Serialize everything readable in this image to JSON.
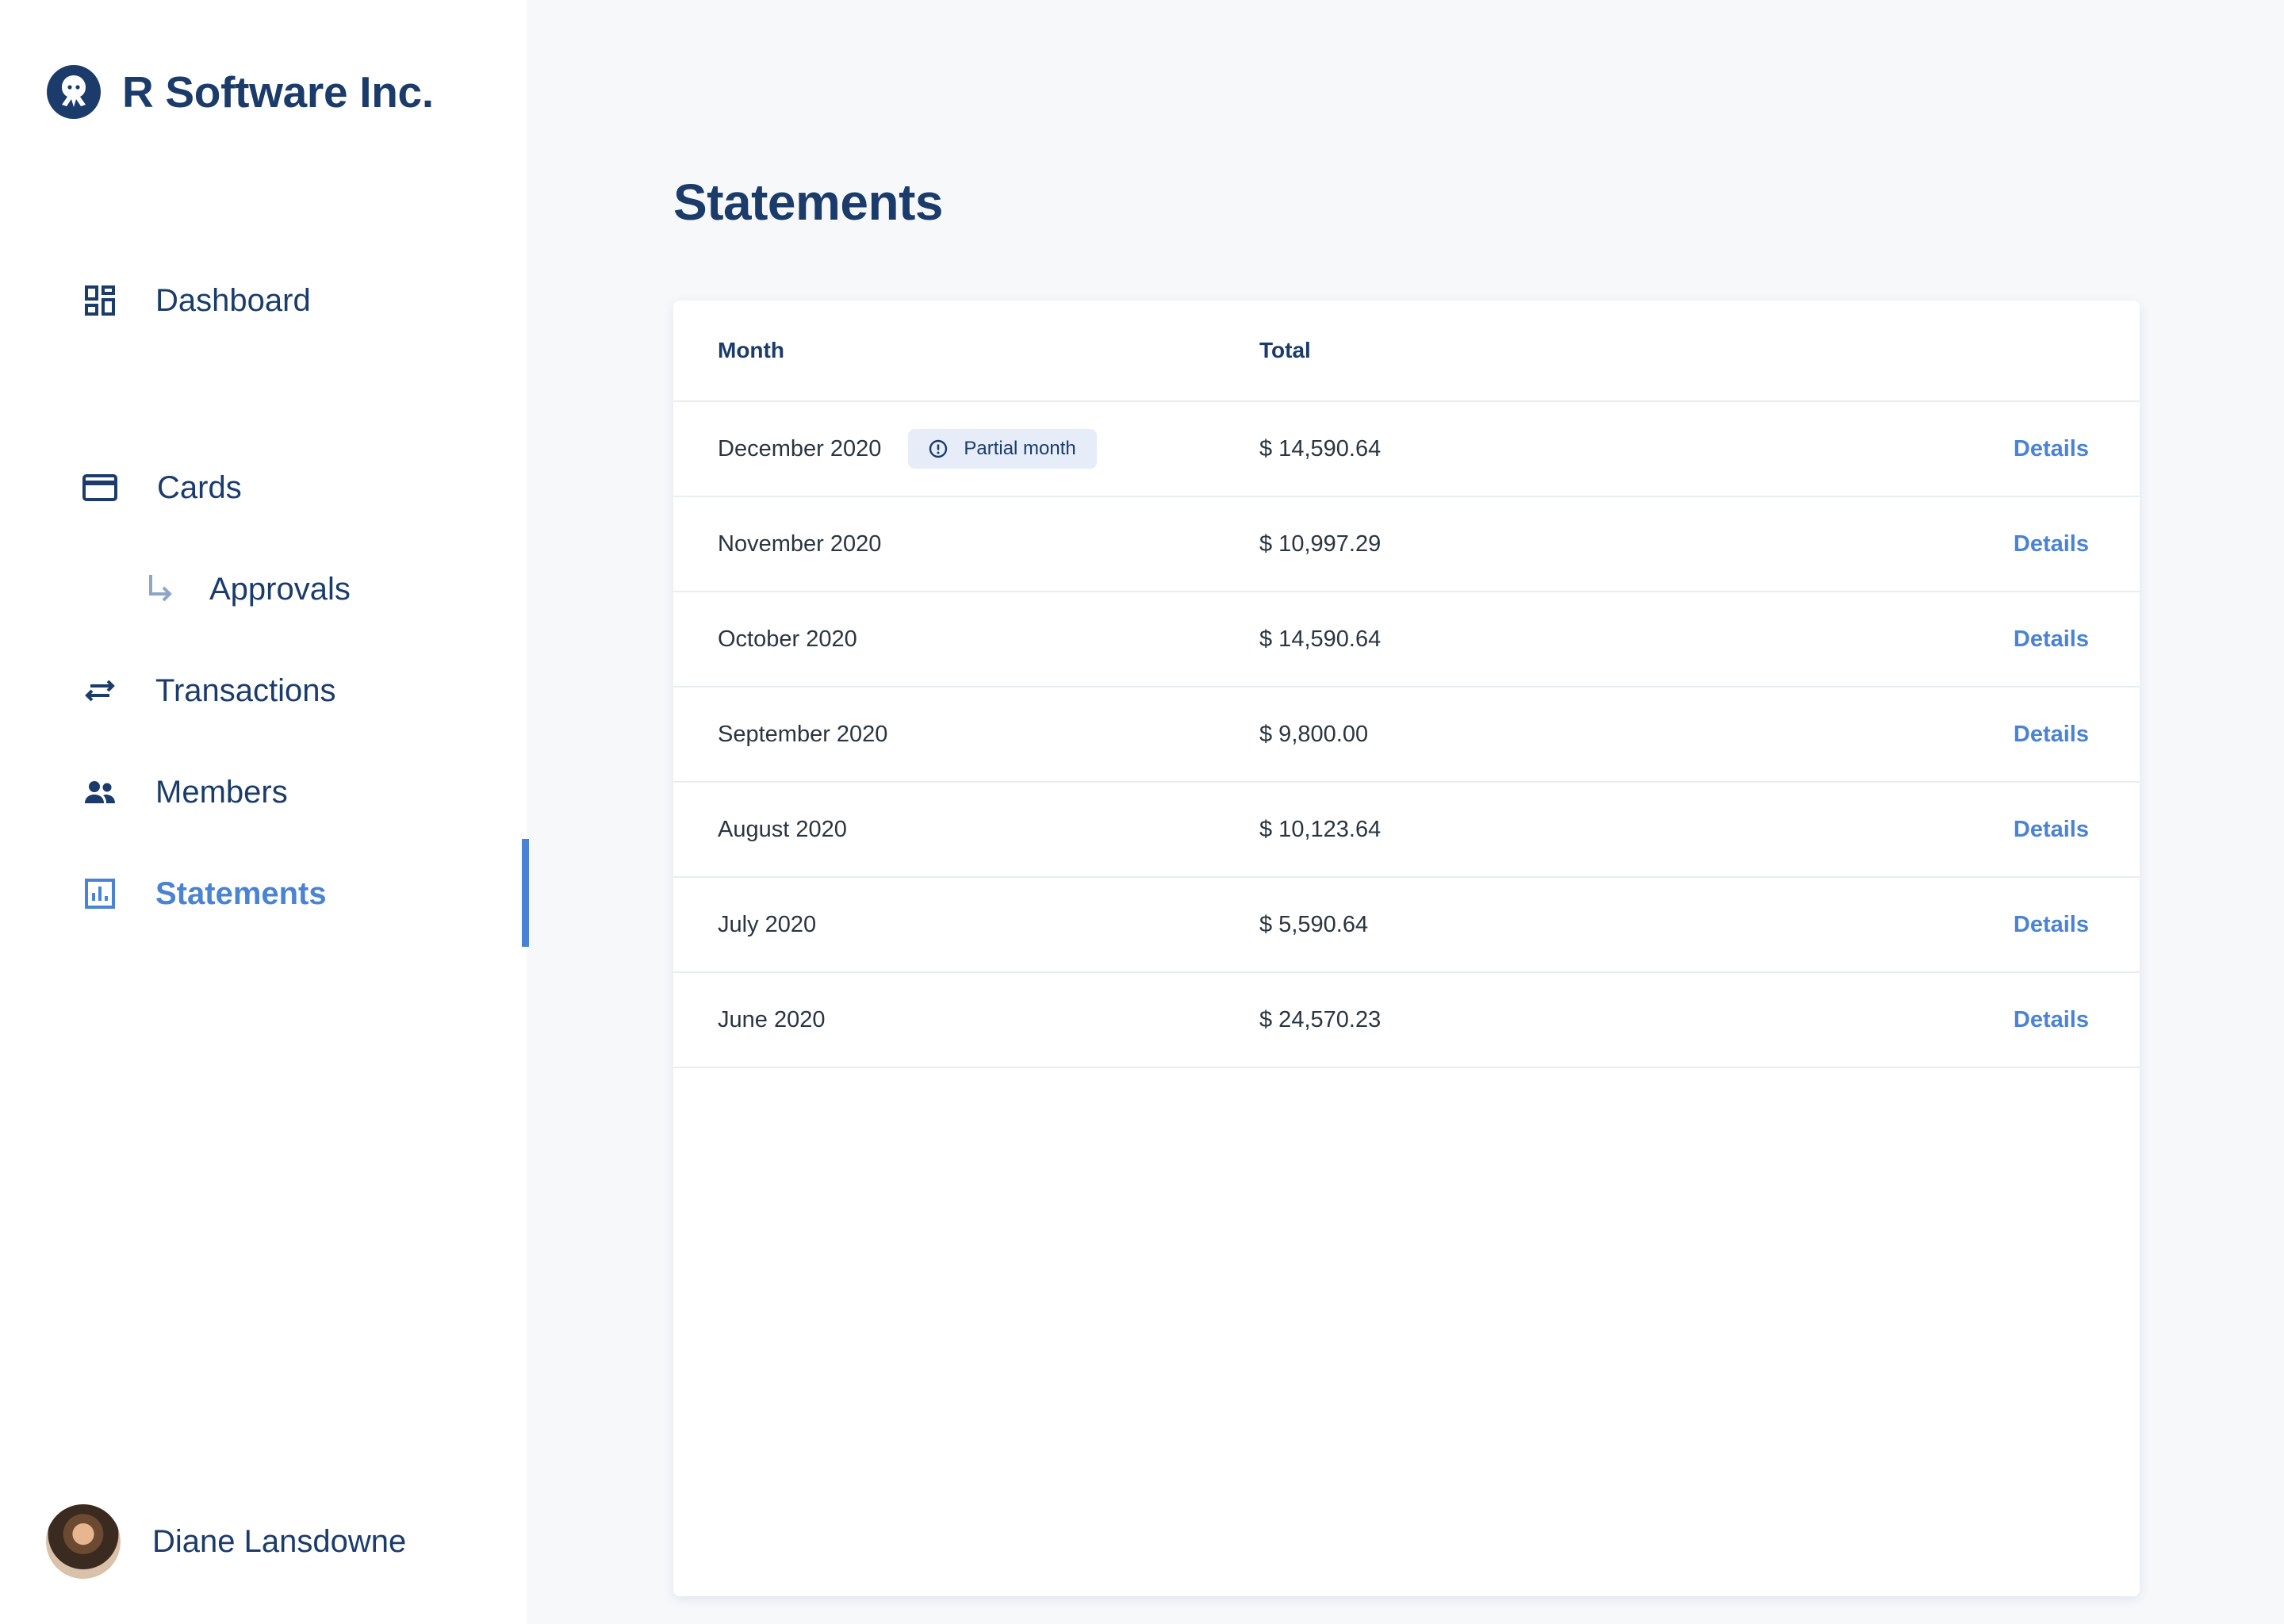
{
  "brand": {
    "name": "R Software Inc.",
    "logo_icon": "octopus-logo-icon"
  },
  "nav": {
    "items": [
      {
        "label": "Dashboard",
        "icon": "dashboard-icon"
      },
      {
        "label": "Cards",
        "icon": "credit-card-icon"
      },
      {
        "label": "Approvals",
        "icon": "subdirectory-arrow-icon"
      },
      {
        "label": "Transactions",
        "icon": "swap-arrows-icon"
      },
      {
        "label": "Members",
        "icon": "people-icon"
      },
      {
        "label": "Statements",
        "icon": "bar-chart-icon",
        "active": true
      }
    ]
  },
  "user": {
    "name": "Diane Lansdowne"
  },
  "page": {
    "title": "Statements"
  },
  "table": {
    "columns": {
      "month": "Month",
      "total": "Total"
    },
    "badge": {
      "label": "Partial month",
      "icon": "info-circle-icon"
    },
    "rows": [
      {
        "month": "December 2020",
        "total": "$ 14,590.64",
        "action": "Details",
        "partial": true
      },
      {
        "month": "November 2020",
        "total": "$ 10,997.29",
        "action": "Details"
      },
      {
        "month": "October 2020",
        "total": "$ 14,590.64",
        "action": "Details"
      },
      {
        "month": "September 2020",
        "total": "$ 9,800.00",
        "action": "Details"
      },
      {
        "month": "August 2020",
        "total": "$ 10,123.64",
        "action": "Details"
      },
      {
        "month": "July 2020",
        "total": "$ 5,590.64",
        "action": "Details"
      },
      {
        "month": "June 2020",
        "total": "$ 24,570.23",
        "action": "Details"
      }
    ]
  },
  "colors": {
    "brand_navy": "#1b3c6b",
    "accent_blue": "#4a83d4",
    "background": "#f7f8fa",
    "badge_bg": "#e6edf8"
  }
}
